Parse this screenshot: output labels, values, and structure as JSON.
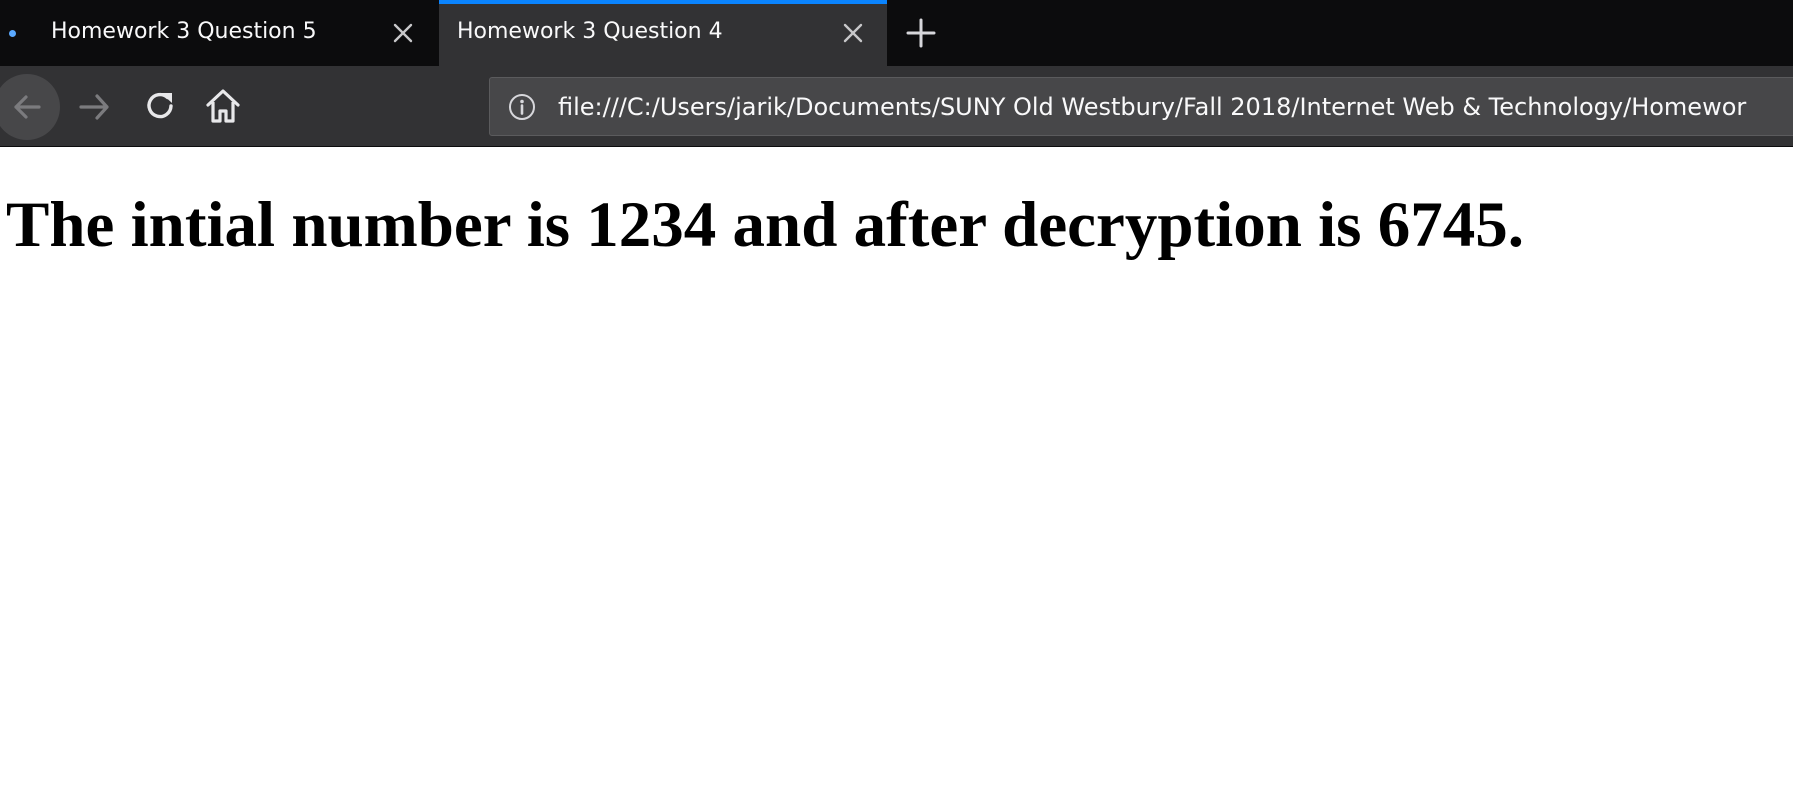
{
  "tabs": [
    {
      "title": "Homework 3 Question 5",
      "active": false
    },
    {
      "title": "Homework 3 Question 4",
      "active": true
    }
  ],
  "toolbar": {
    "back_icon": "arrow-left-icon",
    "forward_icon": "arrow-right-icon",
    "reload_icon": "reload-icon",
    "home_icon": "home-icon"
  },
  "urlbar": {
    "url": "file:///C:/Users/jarik/Documents/SUNY Old Westbury/Fall 2018/Internet Web & Technology/Homewor",
    "info_icon": "info-icon"
  },
  "page": {
    "heading": "The intial number is 1234 and after decryption is 6745."
  },
  "colors": {
    "tab_strip": "#0c0c0d",
    "active_tab": "#323234",
    "accent": "#0a84ff",
    "toolbar": "#323234",
    "urlbar": "#474749",
    "text_light": "#f9f9fa"
  }
}
